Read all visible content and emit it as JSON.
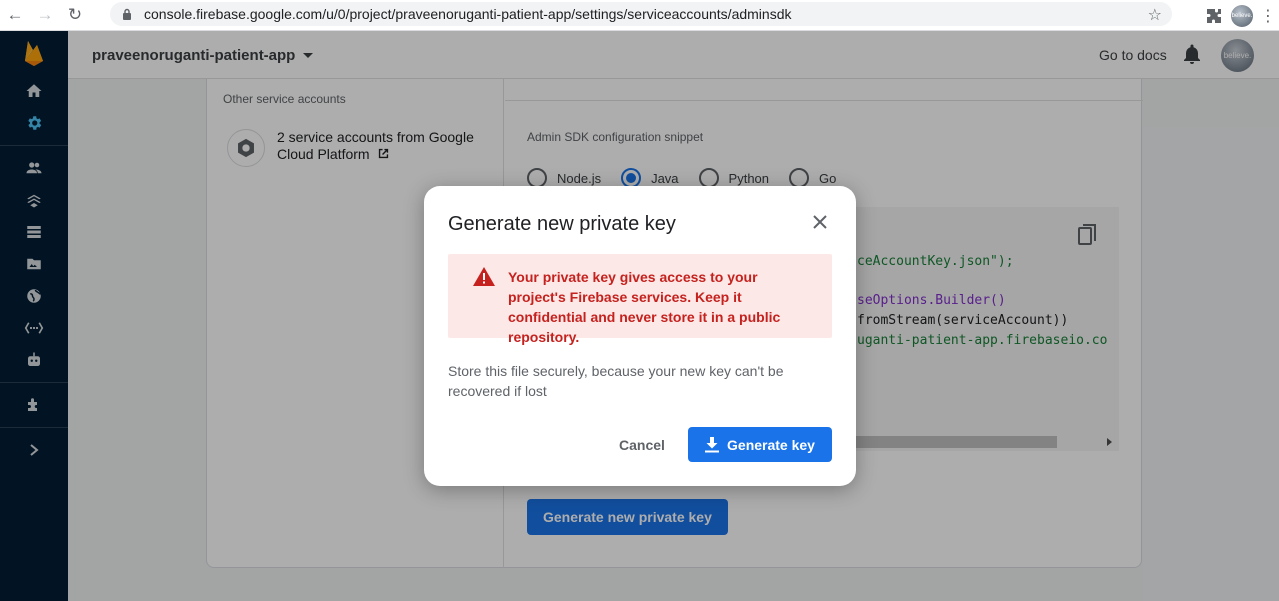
{
  "browser": {
    "url": "console.firebase.google.com/u/0/project/praveenoruganti-patient-app/settings/serviceaccounts/adminsdk",
    "profile_text": "believe."
  },
  "header": {
    "project_name": "praveenoruganti-patient-app",
    "docs_label": "Go to docs",
    "avatar_text": "believe."
  },
  "service_accounts": {
    "other_title": "Other service accounts",
    "gcp_label": "2 service accounts from Google Cloud Platform"
  },
  "snippet": {
    "title": "Admin SDK configuration snippet",
    "options": [
      {
        "label": "Node.js",
        "selected": false
      },
      {
        "label": "Java",
        "selected": true
      },
      {
        "label": "Python",
        "selected": false
      },
      {
        "label": "Go",
        "selected": false
      }
    ],
    "code": {
      "line1": "ceAccountKey.json\");",
      "line2": "seOptions.Builder()",
      "line3": "fromStream(serviceAccount))",
      "line4": "uganti-patient-app.firebaseio.co"
    },
    "generate_button": "Generate new private key"
  },
  "dialog": {
    "title": "Generate new private key",
    "warning": "Your private key gives access to your project's Firebase services. Keep it confidential and never store it in a public repository.",
    "body": "Store this file securely, because your new key can't be recovered if lost",
    "cancel_label": "Cancel",
    "confirm_label": "Generate key"
  },
  "colors": {
    "primary": "#1a73e8",
    "sidebar": "#041e35",
    "warning_bg": "#fce8e6",
    "warning_text": "#c5221f",
    "firebase_orange": "#ffa000"
  }
}
